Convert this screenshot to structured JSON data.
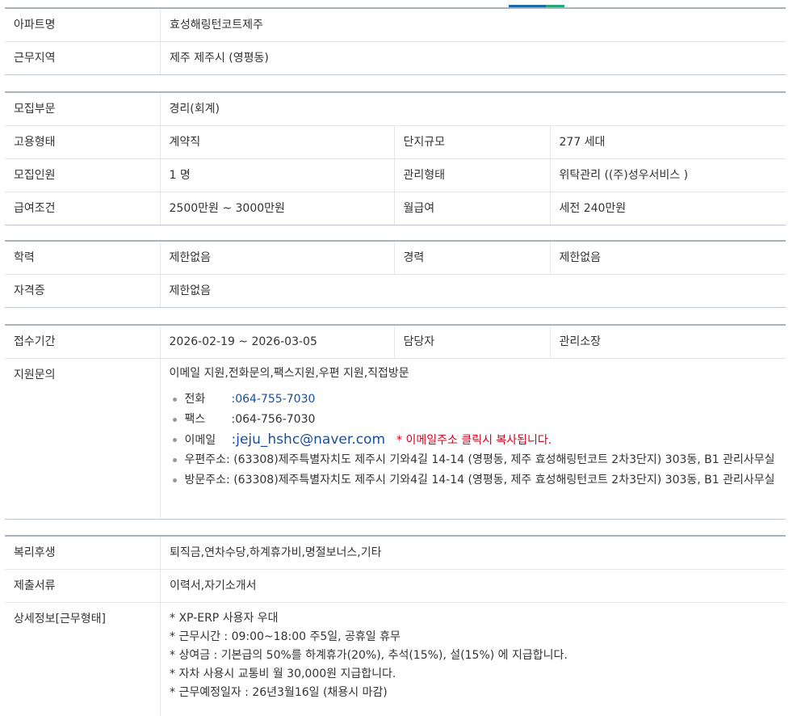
{
  "sections": {
    "basic": {
      "apt_name_label": "아파트명",
      "apt_name": "효성해링턴코트제주",
      "region_label": "근무지역",
      "region": "제주 제주시 (영평동)"
    },
    "recruit": {
      "dept_label": "모집부문",
      "dept": "경리(회계)",
      "employment_label": "고용형태",
      "employment": "계약직",
      "complex_size_label": "단지규모",
      "complex_size": "277 세대",
      "headcount_label": "모집인원",
      "headcount": "1 명",
      "management_label": "관리형태",
      "management": "위탁관리 ((주)성우서비스 )",
      "salary_label": "급여조건",
      "salary": "2500만원 ~ 3000만원",
      "monthly_label": "월급여",
      "monthly": "세전 240만원"
    },
    "qualification": {
      "education_label": "학력",
      "education": "제한없음",
      "career_label": "경력",
      "career": "제한없음",
      "license_label": "자격증",
      "license": "제한없음"
    },
    "apply": {
      "period_label": "접수기간",
      "period": "2026-02-19 ~ 2026-03-05",
      "manager_label": "담당자",
      "manager": "관리소장",
      "inquiry_label": "지원문의",
      "inquiry_methods": "이메일 지원,전화문의,팩스지원,우편 지원,직접방문",
      "phone_label": "전화",
      "phone": ":064-755-7030",
      "fax_label": "팩스",
      "fax": ":064-756-7030",
      "email_label": "이메일",
      "email": ":jeju_hshc@naver.com",
      "email_note": "* 이메일주소 클릭시 복사됩니다.",
      "mail_label": "우편주소",
      "mail": ": (63308)제주특별자치도 제주시 기와4길 14-14 (영평동, 제주 효성해링턴코트 2차3단지) 303동, B1 관리사무실",
      "visit_label": "방문주소",
      "visit": ": (63308)제주특별자치도 제주시 기와4길 14-14 (영평동, 제주 효성해링턴코트 2차3단지) 303동, B1 관리사무실"
    },
    "welfare": {
      "benefits_label": "복리후생",
      "benefits": "퇴직금,연차수당,하계휴가비,명절보너스,기타",
      "documents_label": "제출서류",
      "documents": "이력서,자기소개서",
      "detail_label": "상세정보[근무형태]",
      "detail_lines": [
        "* XP-ERP 사용자 우대",
        "* 근무시간 : 09:00~18:00 주5일, 공휴일 휴무",
        "* 상여금 : 기본급의 50%를 하계휴가(20%), 추석(15%), 설(15%) 에 지급합니다.",
        "* 자차 사용시 교통비 월 30,000원 지급합니다.",
        "* 근무예정일자 : 26년3월16일 (채용시 마감)"
      ]
    }
  }
}
